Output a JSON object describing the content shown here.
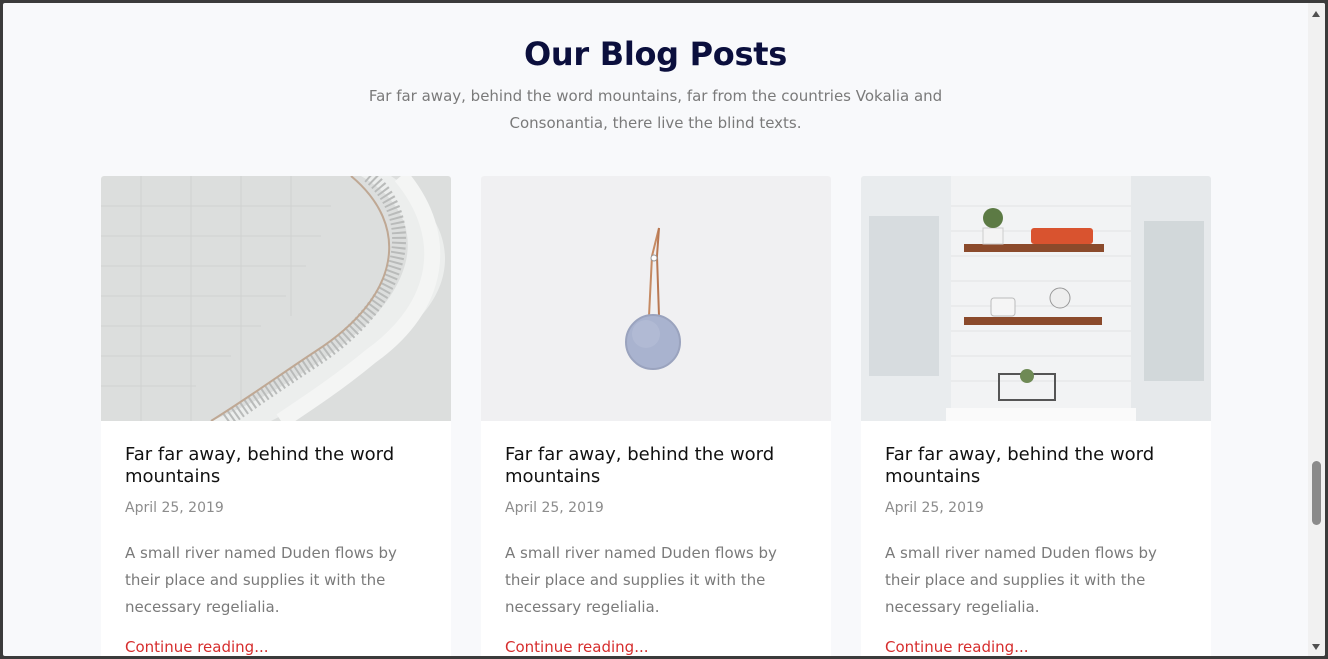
{
  "section": {
    "title": "Our Blog Posts",
    "subtitle": "Far far away, behind the word mountains, far from the countries Vokalia and Consonantia, there live the blind texts."
  },
  "posts": [
    {
      "image": "spiral-staircase-photo",
      "title": "Far far away, behind the word mountains",
      "date": "April 25, 2019",
      "excerpt": "A small river named Duden flows by their place and supplies it with the necessary regelialia.",
      "link": "Continue reading..."
    },
    {
      "image": "hanging-speaker-photo",
      "title": "Far far away, behind the word mountains",
      "date": "April 25, 2019",
      "excerpt": "A small river named Duden flows by their place and supplies it with the necessary regelialia.",
      "link": "Continue reading..."
    },
    {
      "image": "kitchen-shelves-photo",
      "title": "Far far away, behind the word mountains",
      "date": "April 25, 2019",
      "excerpt": "A small river named Duden flows by their place and supplies it with the necessary regelialia.",
      "link": "Continue reading..."
    }
  ],
  "colors": {
    "title": "#0b0f3d",
    "link": "#d62d2d",
    "muted": "#7a7a7a",
    "background": "#f8f9fb"
  },
  "scroll": {
    "position_fraction": 0.72
  }
}
